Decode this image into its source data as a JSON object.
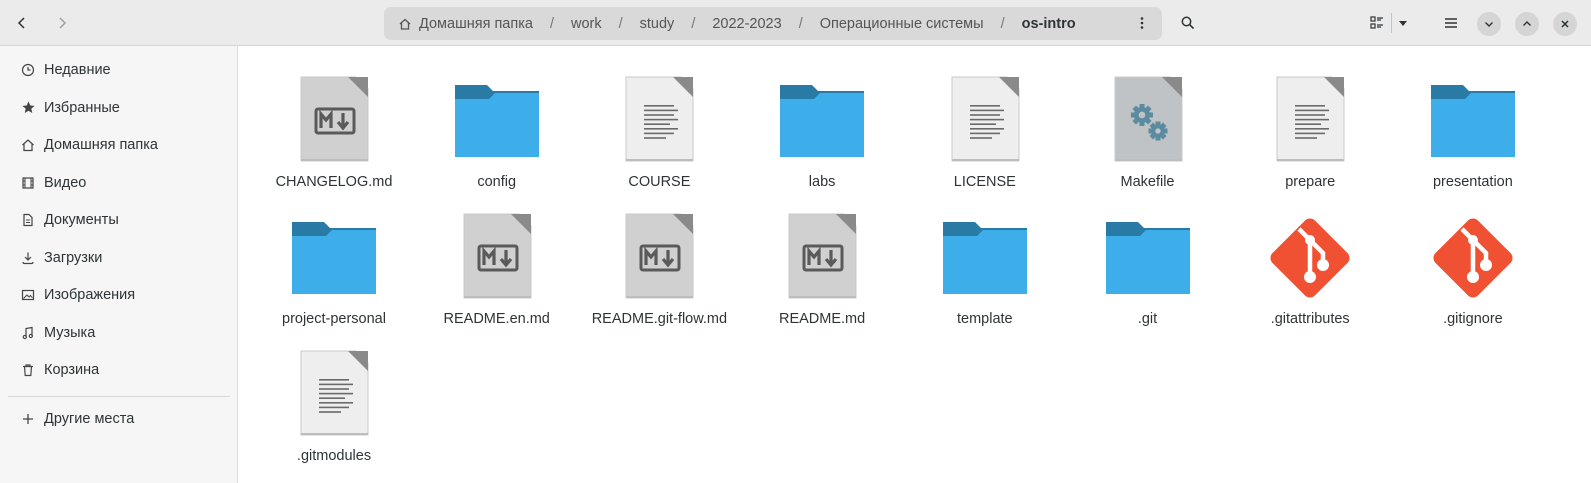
{
  "header": {
    "path": [
      {
        "label": "Домашняя папка",
        "icon": "home-icon"
      },
      {
        "label": "work"
      },
      {
        "label": "study"
      },
      {
        "label": "2022-2023"
      },
      {
        "label": "Операционные системы"
      },
      {
        "label": "os-intro",
        "current": true
      }
    ],
    "separator": "/"
  },
  "sidebar": {
    "items": [
      {
        "label": "Недавние",
        "icon": "clock-icon"
      },
      {
        "label": "Избранные",
        "icon": "star-icon"
      },
      {
        "label": "Домашняя папка",
        "icon": "home-icon"
      },
      {
        "label": "Видео",
        "icon": "film-icon"
      },
      {
        "label": "Документы",
        "icon": "document-icon"
      },
      {
        "label": "Загрузки",
        "icon": "download-icon"
      },
      {
        "label": "Изображения",
        "icon": "image-icon"
      },
      {
        "label": "Музыка",
        "icon": "music-icon"
      },
      {
        "label": "Корзина",
        "icon": "trash-icon"
      }
    ],
    "other_places": {
      "label": "Другие места",
      "icon": "plus-icon"
    }
  },
  "files": [
    {
      "name": "CHANGELOG.md",
      "type": "markdown"
    },
    {
      "name": "config",
      "type": "folder"
    },
    {
      "name": "COURSE",
      "type": "text"
    },
    {
      "name": "labs",
      "type": "folder"
    },
    {
      "name": "LICENSE",
      "type": "text"
    },
    {
      "name": "Makefile",
      "type": "makefile"
    },
    {
      "name": "prepare",
      "type": "text"
    },
    {
      "name": "presentation",
      "type": "folder"
    },
    {
      "name": "project-personal",
      "type": "folder"
    },
    {
      "name": "README.en.md",
      "type": "markdown"
    },
    {
      "name": "README.git-flow.md",
      "type": "markdown"
    },
    {
      "name": "README.md",
      "type": "markdown"
    },
    {
      "name": "template",
      "type": "folder"
    },
    {
      "name": ".git",
      "type": "folder"
    },
    {
      "name": ".gitattributes",
      "type": "git"
    },
    {
      "name": ".gitignore",
      "type": "git"
    },
    {
      "name": ".gitmodules",
      "type": "text"
    }
  ],
  "colors": {
    "folder_front": "#3daee9",
    "folder_back": "#2a7aa6",
    "git": "#f05133",
    "doc": "#eeeeee",
    "markdown": "#d0d0d0"
  }
}
